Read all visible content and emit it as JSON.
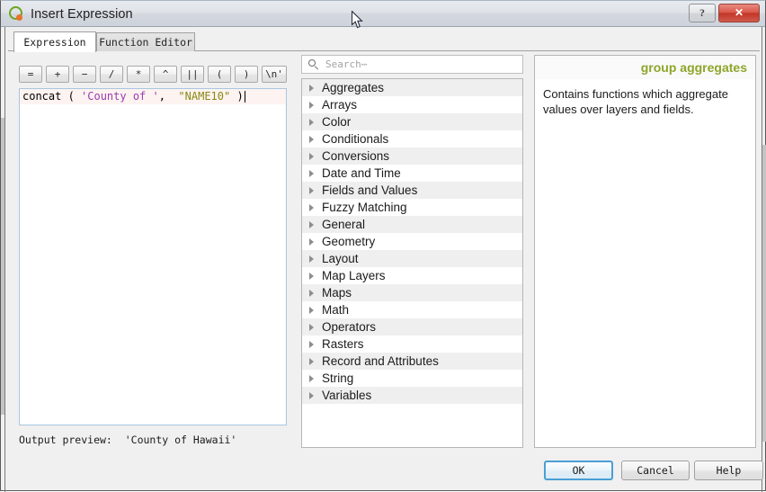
{
  "window": {
    "title": "Insert Expression",
    "logo_icon": "qgis-logo-icon",
    "help_button_label": "?",
    "close_button_label": "✕"
  },
  "tabs": [
    {
      "label": "Expression",
      "active": true
    },
    {
      "label": "Function Editor",
      "active": false
    }
  ],
  "operator_buttons": [
    {
      "label": "=",
      "name": "operator-equals"
    },
    {
      "label": "+",
      "name": "operator-plus"
    },
    {
      "label": "−",
      "name": "operator-minus"
    },
    {
      "label": "/",
      "name": "operator-divide"
    },
    {
      "label": "*",
      "name": "operator-multiply"
    },
    {
      "label": "^",
      "name": "operator-power"
    },
    {
      "label": "||",
      "name": "operator-concat"
    },
    {
      "label": "(",
      "name": "operator-open-paren"
    },
    {
      "label": ")",
      "name": "operator-close-paren"
    },
    {
      "label": "\\n'",
      "name": "operator-newline"
    }
  ],
  "expression": {
    "full_text": "concat ( 'County of ', \"NAME10\" )",
    "tokens": {
      "function_name": "concat ",
      "open_paren": "( ",
      "string_literal": "'County of '",
      "comma": ",  ",
      "field_ref": "\"NAME10\"",
      "close_paren": " )"
    },
    "colors": {
      "string_literal": "#9a3cb0",
      "field_ref": "#8a8a14",
      "plain": "#000000",
      "line_highlight": "#fdf3f0"
    }
  },
  "output_preview": {
    "label": "Output preview:",
    "value": "'County of Hawaii'"
  },
  "search": {
    "placeholder": "Search⋯",
    "value": "",
    "icon": "search-icon"
  },
  "function_tree": {
    "items": [
      "Aggregates",
      "Arrays",
      "Color",
      "Conditionals",
      "Conversions",
      "Date and Time",
      "Fields and Values",
      "Fuzzy Matching",
      "General",
      "Geometry",
      "Layout",
      "Map Layers",
      "Maps",
      "Math",
      "Operators",
      "Rasters",
      "Record and Attributes",
      "String",
      "Variables"
    ]
  },
  "help_panel": {
    "title": "group aggregates",
    "title_color": "#8da52a",
    "body": "Contains functions which aggregate values over layers and fields."
  },
  "dialog_buttons": {
    "ok": "OK",
    "cancel": "Cancel",
    "help": "Help"
  }
}
